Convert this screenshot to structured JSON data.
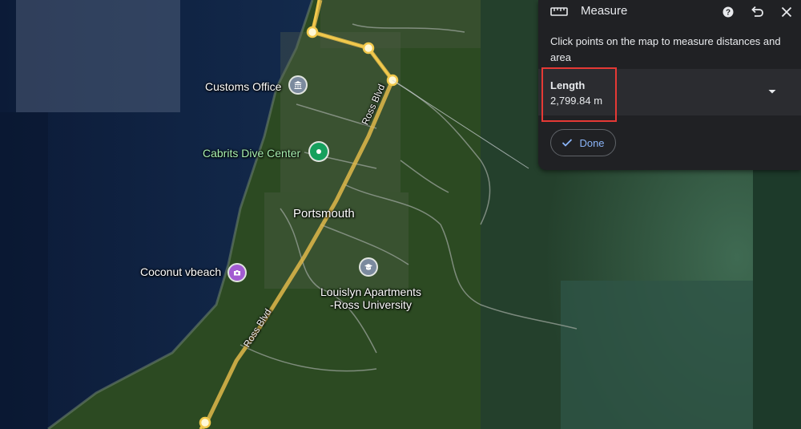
{
  "map": {
    "labels": {
      "customs_office": "Customs Office",
      "cabrits_dive_center": "Cabrits Dive Center",
      "portsmouth": "Portsmouth",
      "coconut_beach": "Coconut vbeach",
      "louislyn_line1": "Louislyn Apartments",
      "louislyn_line2": "-Ross University",
      "ross_blvd_upper": "Ross Blvd",
      "ross_blvd_lower": "Ross Blvd"
    },
    "colors": {
      "measure_line": "#f2c94c",
      "water": "#0d1f3d",
      "land": "#2f4a24"
    }
  },
  "panel": {
    "title": "Measure",
    "help_icon": "help-icon",
    "undo_icon": "undo-icon",
    "close_icon": "close-icon",
    "description": "Click points on the map to measure distances and area",
    "length_label": "Length",
    "length_value": "2,799.84 m",
    "done_label": "Done",
    "highlight_color": "#e53935",
    "accent_color": "#8ab4f8"
  }
}
